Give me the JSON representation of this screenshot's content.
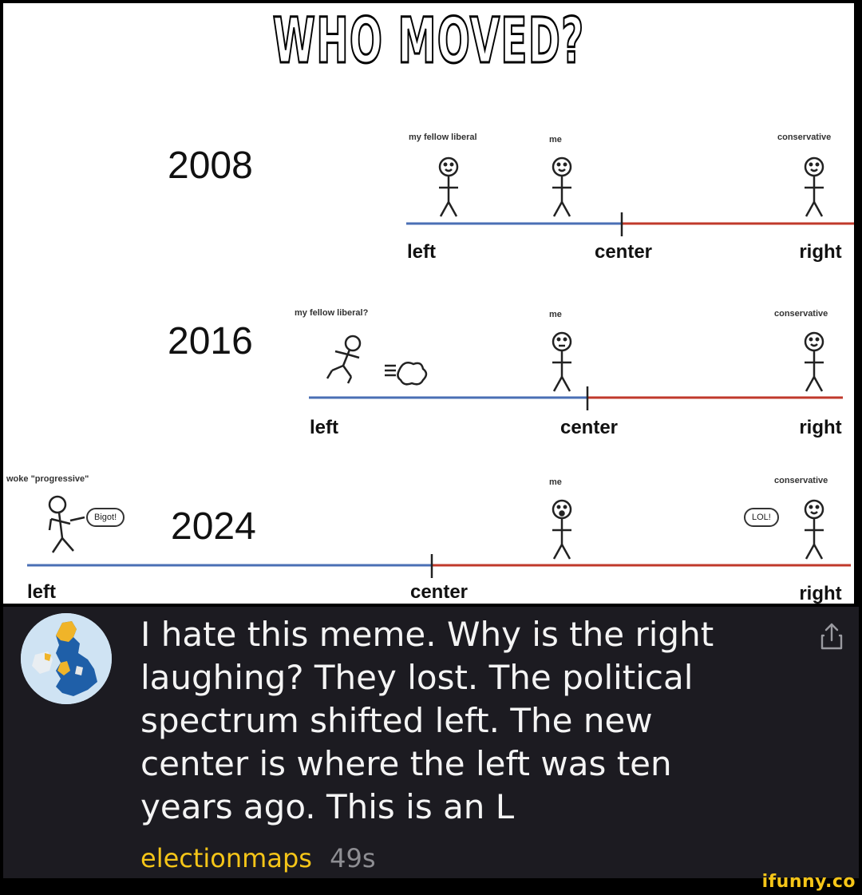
{
  "meme": {
    "headline": "WHO MOVED?",
    "panels": [
      {
        "year": "2008",
        "figures": [
          {
            "label": "my fellow liberal",
            "face": "smile"
          },
          {
            "label": "me",
            "face": "smile"
          },
          {
            "label": "conservative",
            "face": "smile"
          }
        ],
        "axis": {
          "left": "left",
          "center": "center",
          "right": "right"
        }
      },
      {
        "year": "2016",
        "figures": [
          {
            "label": "my fellow liberal?",
            "face": "running"
          },
          {
            "label": "me",
            "face": "neutral"
          },
          {
            "label": "conservative",
            "face": "smile"
          }
        ],
        "axis": {
          "left": "left",
          "center": "center",
          "right": "right"
        }
      },
      {
        "year": "2024",
        "figures": [
          {
            "label": "woke \"progressive\"",
            "face": "angry",
            "speech": "Bigot!"
          },
          {
            "label": "me",
            "face": "shocked"
          },
          {
            "label": "conservative",
            "face": "smile",
            "speech": "LOL!"
          }
        ],
        "axis": {
          "left": "left",
          "center": "center",
          "right": "right"
        }
      }
    ],
    "colors": {
      "left_line": "#4a6fb5",
      "right_line": "#c0392b"
    }
  },
  "comment": {
    "text": "I hate this meme. Why is the right laughing? They lost. The political spectrum shifted left. The new center is where the left was ten years ago. This is an L",
    "author": "electionmaps",
    "time": "49s",
    "share_icon": "share-icon",
    "avatar_icon": "uk-election-map-avatar"
  },
  "watermark": "ifunny.co",
  "colors": {
    "author": "#f5c518",
    "background": "#1c1b21",
    "meta": "#8e8e93"
  }
}
